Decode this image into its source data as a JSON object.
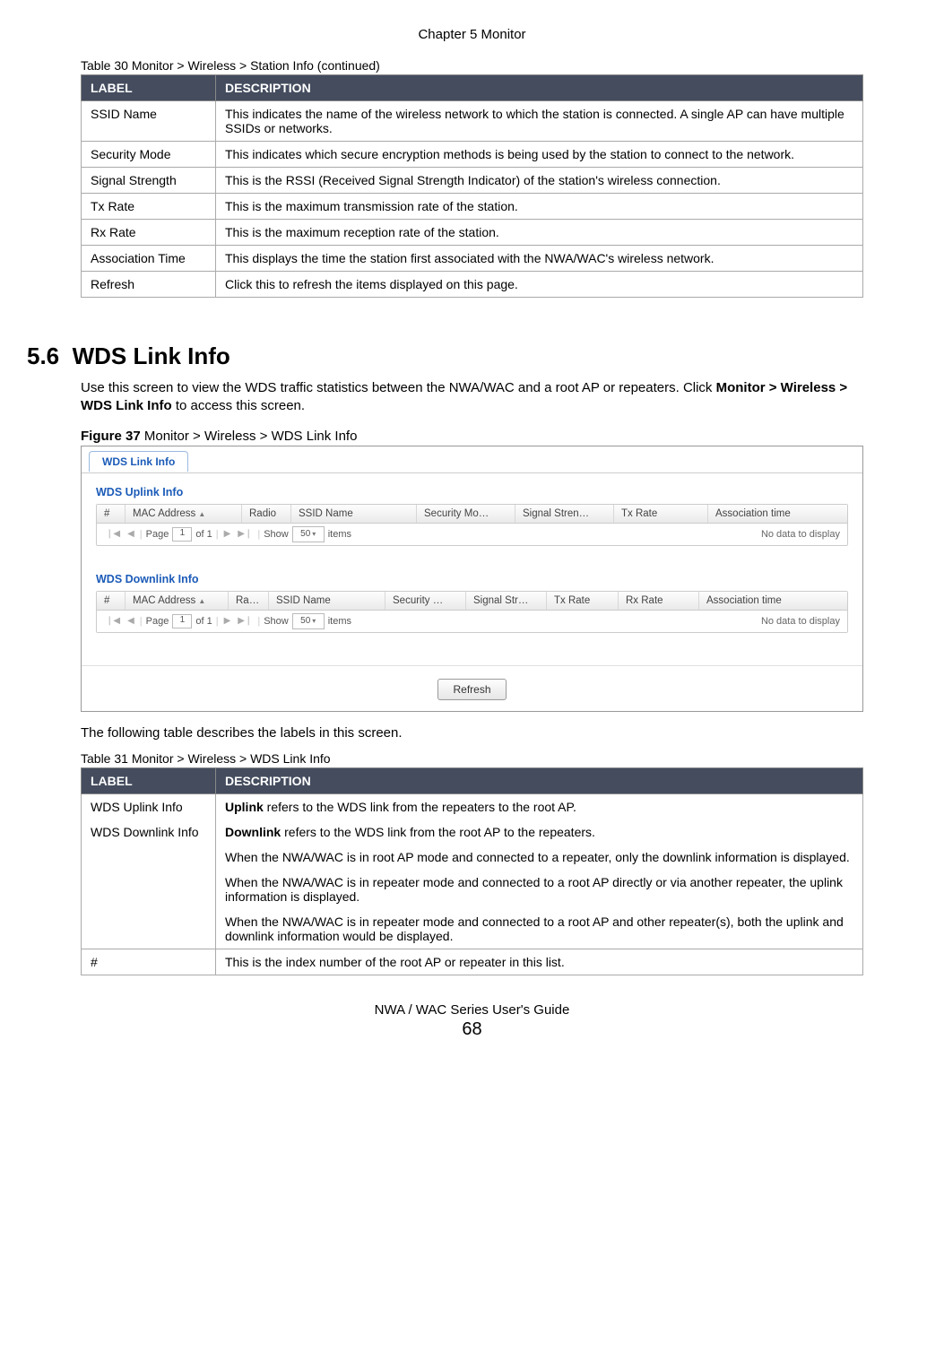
{
  "chapter_head": "Chapter 5 Monitor",
  "table30": {
    "caption": "Table 30   Monitor > Wireless > Station Info (continued)",
    "headers": {
      "label": "LABEL",
      "desc": "DESCRIPTION"
    },
    "rows": [
      {
        "label": "SSID Name",
        "desc": "This indicates the name of the wireless network to which the station is connected. A single AP can have multiple SSIDs or networks."
      },
      {
        "label": "Security Mode",
        "desc": "This indicates which secure encryption methods is being used by the station to connect to the network."
      },
      {
        "label": "Signal Strength",
        "desc": "This is the RSSI (Received Signal Strength Indicator) of the station's wireless connection."
      },
      {
        "label": "Tx Rate",
        "desc": "This is the maximum transmission rate of the station."
      },
      {
        "label": "Rx Rate",
        "desc": "This is the maximum reception rate of the station."
      },
      {
        "label": "Association Time",
        "desc": "This displays the time the station first associated with the NWA/WAC's wireless network."
      },
      {
        "label": "Refresh",
        "desc": "Click this to refresh the items displayed on this page."
      }
    ]
  },
  "section": {
    "number": "5.6",
    "title": "WDS Link Info",
    "intro_1": "Use this screen to view the WDS traffic statistics between the NWA/WAC and a root AP or repeaters. Click ",
    "intro_bold": "Monitor > Wireless > WDS Link Info",
    "intro_2": " to access this screen."
  },
  "figure37": {
    "caption_bold": "Figure 37",
    "caption_rest": "   Monitor > Wireless > WDS Link Info",
    "tab_label": "WDS Link Info",
    "uplink_title": "WDS Uplink Info",
    "downlink_title": "WDS Downlink Info",
    "uplink_cols": [
      "#",
      "MAC Address",
      "Radio",
      "SSID Name",
      "Security Mo…",
      "Signal Stren…",
      "Tx Rate",
      "Association time"
    ],
    "downlink_cols": [
      "#",
      "MAC Address",
      "Ra…",
      "SSID Name",
      "Security …",
      "Signal Str…",
      "Tx Rate",
      "Rx Rate",
      "Association time"
    ],
    "pager": {
      "page_label": "Page",
      "page_value": "1",
      "of_label": "of 1",
      "show_label": "Show",
      "show_value": "50",
      "items_label": "items",
      "nodata": "No data to display"
    },
    "refresh_label": "Refresh"
  },
  "following_text": "The following table describes the labels in this screen.",
  "table31": {
    "caption": "Table 31   Monitor > Wireless > WDS Link Info",
    "headers": {
      "label": "LABEL",
      "desc": "DESCRIPTION"
    },
    "row1": {
      "label_line1": "WDS Uplink Info",
      "label_line2": "WDS Downlink Info",
      "p1_b": "Uplink",
      "p1_rest": " refers to the WDS link from the repeaters to the root AP.",
      "p2_b": "Downlink",
      "p2_rest": " refers to the WDS link from the root AP to the repeaters.",
      "p3": "When the NWA/WAC is in root AP mode and connected to a repeater, only the downlink information is displayed.",
      "p4": "When the NWA/WAC is in repeater mode and connected to a root AP directly or via another repeater, the uplink information is displayed.",
      "p5": "When the NWA/WAC is in repeater mode and connected to a root AP and other repeater(s), both the uplink and downlink information would be displayed."
    },
    "row2": {
      "label": "#",
      "desc": "This is the index number of the root AP or repeater in this list."
    }
  },
  "footer": {
    "guide": "NWA / WAC Series User's Guide",
    "page": "68"
  }
}
